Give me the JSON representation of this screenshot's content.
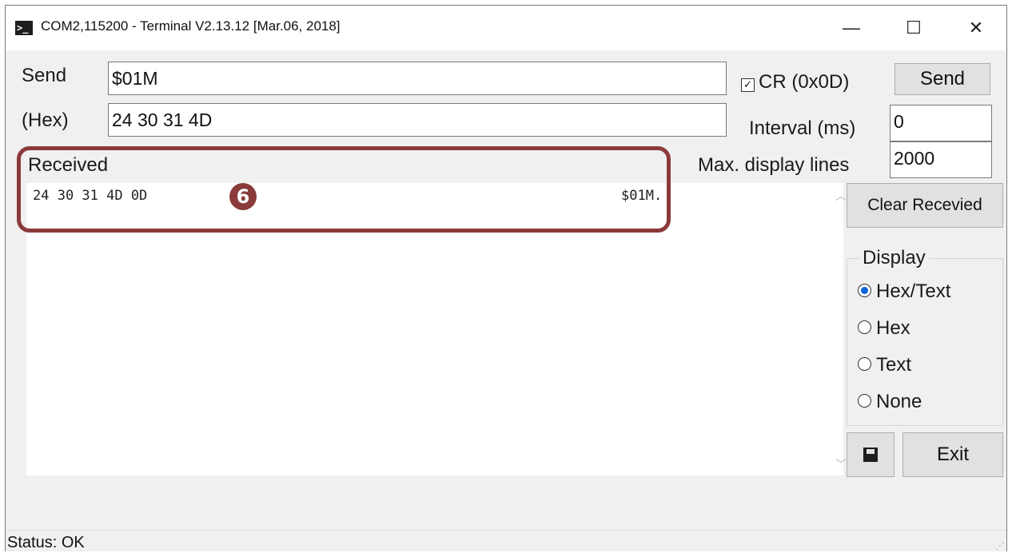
{
  "window": {
    "title": "COM2,115200 - Terminal V2.13.12 [Mar.06, 2018]",
    "controls": {
      "minimize": "—",
      "maximize": "☐",
      "close": "✕"
    }
  },
  "send_row": {
    "label": "Send",
    "value": "$01M",
    "cr_label": "CR (0x0D)",
    "cr_checked": true,
    "button": "Send"
  },
  "hex_row": {
    "label": "(Hex)",
    "value": "24 30 31 4D"
  },
  "interval": {
    "label": "Interval (ms)",
    "value": "0"
  },
  "max_lines": {
    "label": "Max. display lines",
    "value": "2000"
  },
  "received": {
    "label": "Received",
    "hex": "24 30 31 4D 0D",
    "text": "$01M.",
    "marker": "6"
  },
  "buttons": {
    "clear": "Clear Recevied",
    "exit": "Exit"
  },
  "display": {
    "legend": "Display",
    "options": [
      "Hex/Text",
      "Hex",
      "Text",
      "None"
    ],
    "selected": "Hex/Text"
  },
  "status": "Status: OK",
  "colors": {
    "highlight": "#8b3a3a",
    "radio_selected": "#0a64d8"
  }
}
